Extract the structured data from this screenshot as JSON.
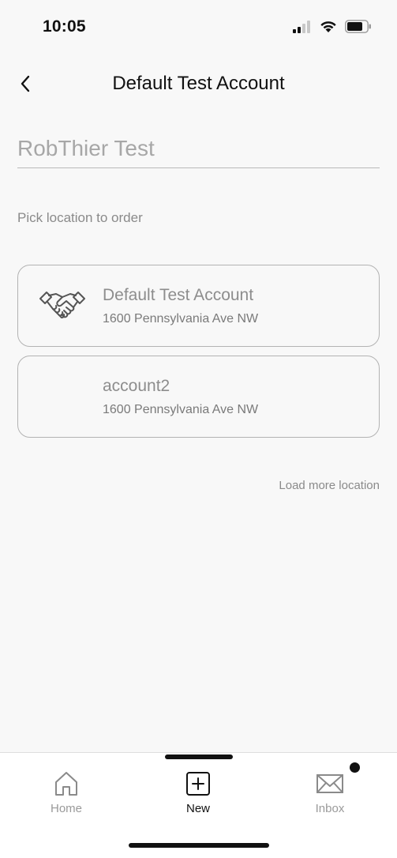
{
  "status_bar": {
    "time": "10:05",
    "icons": [
      "signal-icon",
      "wifi-icon",
      "battery-icon"
    ]
  },
  "nav": {
    "back_icon": "chevron-left-icon",
    "title": "Default Test Account"
  },
  "name_field": {
    "value": "RobThier Test"
  },
  "pick_label": "Pick location to order",
  "locations": [
    {
      "icon": "handshake-icon",
      "name": "Default Test Account",
      "address": "1600 Pennsylvania Ave NW"
    },
    {
      "icon": "",
      "name": "account2",
      "address": "1600 Pennsylvania Ave NW"
    }
  ],
  "load_more": "Load more location",
  "tab_bar": {
    "tabs": [
      {
        "label": "Home",
        "icon": "home-icon",
        "active": false
      },
      {
        "label": "New",
        "icon": "plus-square-icon",
        "active": true
      },
      {
        "label": "Inbox",
        "icon": "mail-icon",
        "active": false,
        "badge": true
      }
    ]
  },
  "colors": {
    "background": "#f8f8f8",
    "text_primary": "#111111",
    "text_muted": "#8a8a8a",
    "border": "#b3b3b3"
  }
}
